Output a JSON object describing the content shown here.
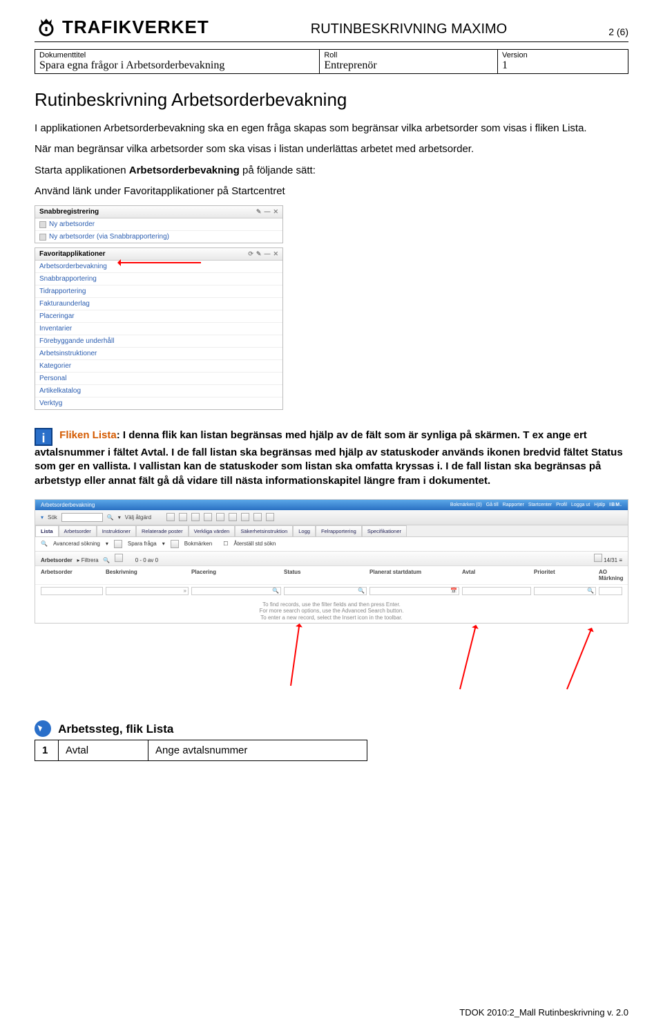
{
  "header": {
    "brand": "TRAFIKVERKET",
    "doc_kind": "RUTINBESKRIVNING MAXIMO",
    "page_indicator": "2 (6)"
  },
  "meta": {
    "labels": {
      "title": "Dokumenttitel",
      "role": "Roll",
      "version": "Version"
    },
    "values": {
      "title": "Spara egna frågor i Arbetsorderbevakning",
      "role": "Entreprenör",
      "version": "1"
    }
  },
  "title": "Rutinbeskrivning Arbetsorderbevakning",
  "paragraphs": {
    "p1a": "I applikationen Arbetsorderbevakning ska en egen fråga skapas som begränsar vilka arbetsorder som visas i fliken Lista.",
    "p1b": "När man begränsar vilka arbetsorder som ska visas i listan underlättas arbetet med arbetsorder.",
    "p2a": "Starta applikationen ",
    "p2b": "Arbetsorderbevakning",
    "p2c": " på följande sätt:",
    "p3": "Använd länk under Favoritapplikationer på Startcentret"
  },
  "snabb": {
    "title": "Snabbregistrering",
    "rows": [
      "Ny arbetsorder",
      "Ny arbetsorder (via Snabbrapportering)"
    ]
  },
  "fav": {
    "title": "Favoritapplikationer",
    "rows": [
      "Arbetsorderbevakning",
      "Snabbrapportering",
      "Tidrapportering",
      "Fakturaunderlag",
      "Placeringar",
      "Inventarier",
      "Förebyggande underhåll",
      "Arbetsinstruktioner",
      "Kategorier",
      "Personal",
      "Artikelkatalog",
      "Verktyg"
    ]
  },
  "info": {
    "lead_label": "Fliken Lista",
    "text": ": I denna flik kan listan begränsas med hjälp av de fält som är synliga på skärmen. T ex ange ert avtalsnummer i fältet Avtal. I de fall listan ska begränsas med hjälp av statuskoder används ikonen bredvid fältet Status som ger en vallista. I vallistan kan de statuskoder som listan ska omfatta kryssas i. I de fall listan ska begränsas på arbetstyp eller annat fält gå då vidare till nästa informationskapitel längre fram i dokumentet."
  },
  "maximo": {
    "app_title": "Arbetsorderbevakning",
    "top_right": [
      "Bokmärken (0)",
      "Gå till",
      "Rapporter",
      "Startcenter",
      "Profil",
      "Logga ut",
      "Hjälp"
    ],
    "search_label": "Sök",
    "search_dropdown": "Välj åtgärd",
    "tabs": [
      "Lista",
      "Arbetsorder",
      "Instruktioner",
      "Relaterade poster",
      "Verkliga värden",
      "Säkerhetsinstruktion",
      "Logg",
      "Felrapportering",
      "Specifikationer"
    ],
    "toolbar": {
      "adv": "Avancerad sökning",
      "save": "Spara fråga",
      "bookmarks": "Bokmärken",
      "filter_label": "Återställ std sökn"
    },
    "section": {
      "label": "Arbetsorder",
      "filter": "Filtrera",
      "count": "0 - 0 av 0",
      "right": "14/31"
    },
    "columns": [
      "Arbetsorder",
      "Beskrivning",
      "Placering",
      "Status",
      "Planerat startdatum",
      "Avtal",
      "Prioritet",
      "AO Märkning"
    ],
    "hint1": "To find records, use the filter fields and then press Enter.",
    "hint2": "For more search options, use the Advanced Search button.",
    "hint3": "To enter a new record, select the Insert icon in the toolbar."
  },
  "steps": {
    "title": "Arbetssteg, flik Lista",
    "rows": [
      {
        "n": "1",
        "key": "Avtal",
        "val": "Ange avtalsnummer"
      }
    ]
  },
  "footer": "TDOK 2010:2_Mall Rutinbeskrivning v. 2.0"
}
